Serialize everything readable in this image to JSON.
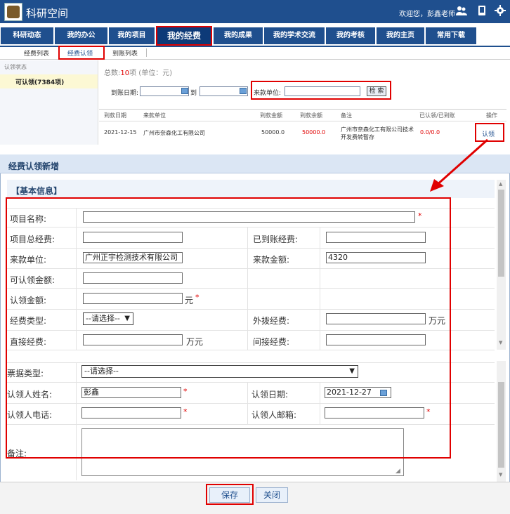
{
  "header": {
    "site_title": "科研空间",
    "welcome": "欢迎您，彭鑫老师",
    "icons": [
      "users-icon",
      "mobile-icon",
      "gear-icon"
    ]
  },
  "main_nav": [
    {
      "label": "科研动态"
    },
    {
      "label": "我的办公"
    },
    {
      "label": "我的项目"
    },
    {
      "label": "我的经费",
      "active": true
    },
    {
      "label": "我的成果"
    },
    {
      "label": "我的学术交流"
    },
    {
      "label": "我的考核"
    },
    {
      "label": "我的主页"
    },
    {
      "label": "常用下载"
    }
  ],
  "sub_nav": [
    {
      "label": "经费列表"
    },
    {
      "label": "经费认领",
      "active": true
    },
    {
      "label": "到账列表"
    }
  ],
  "sidebar": {
    "title": "认领状态",
    "item": "可认领(7384项)"
  },
  "list": {
    "total_prefix": "总数:",
    "total_count": "10",
    "total_suffix": "项 (单位：元)",
    "filter": {
      "date_label": "到账日期:",
      "to_label": "到",
      "payer_label": "来款单位:",
      "search_label": "检 索"
    },
    "columns": [
      "到款日期",
      "来款单位",
      "到款金额",
      "到款余额",
      "备注",
      "已认领/已到账",
      "操作"
    ],
    "rows": [
      {
        "date": "2021-12-15",
        "payer": "广州市奈森化工有限公司",
        "amount": "50000.0",
        "balance": "50000.0",
        "note_1": "广州市奈森化工有限公司技术",
        "note_2": "开发费转暂存",
        "claimed": "0.0/0.0",
        "action": "认领"
      }
    ]
  },
  "dialog": {
    "title": "经费认领新增",
    "section": "【基本信息】",
    "fields": {
      "project_name": {
        "label": "项目名称:",
        "value": ""
      },
      "total_funds": {
        "label": "项目总经费:",
        "value": ""
      },
      "received_funds": {
        "label": "已到账经费:",
        "value": ""
      },
      "payer": {
        "label": "来款单位:",
        "value": "广州正宇检测技术有限公司"
      },
      "amount": {
        "label": "来款金额:",
        "value": "4320"
      },
      "claimable": {
        "label": "可认领金额:",
        "value": ""
      },
      "claim_amount": {
        "label": "认领金额:",
        "value": "",
        "unit": "元"
      },
      "fund_type": {
        "label": "经费类型:",
        "value": "--请选择--"
      },
      "external_funds": {
        "label": "外拨经费:",
        "value": "",
        "unit": "万元"
      },
      "direct_funds": {
        "label": "直接经费:",
        "value": "",
        "unit": "万元"
      },
      "indirect_funds": {
        "label": "间接经费:",
        "value": ""
      },
      "invoice_type": {
        "label": "票据类型:",
        "value": "--请选择--"
      },
      "claimer_name": {
        "label": "认领人姓名:",
        "value": "彭鑫"
      },
      "claim_date": {
        "label": "认领日期:",
        "value": "2021-12-27"
      },
      "claimer_phone": {
        "label": "认领人电话:",
        "value": ""
      },
      "claimer_email": {
        "label": "认领人邮箱:",
        "value": ""
      },
      "notes": {
        "label": "备注:",
        "value": ""
      }
    },
    "required_mark": "*",
    "buttons": {
      "save": "保存",
      "close": "关闭"
    }
  },
  "colors": {
    "nav_blue": "#1f4f8e",
    "highlight_red": "#e00000",
    "amount_red": "#e00000"
  }
}
